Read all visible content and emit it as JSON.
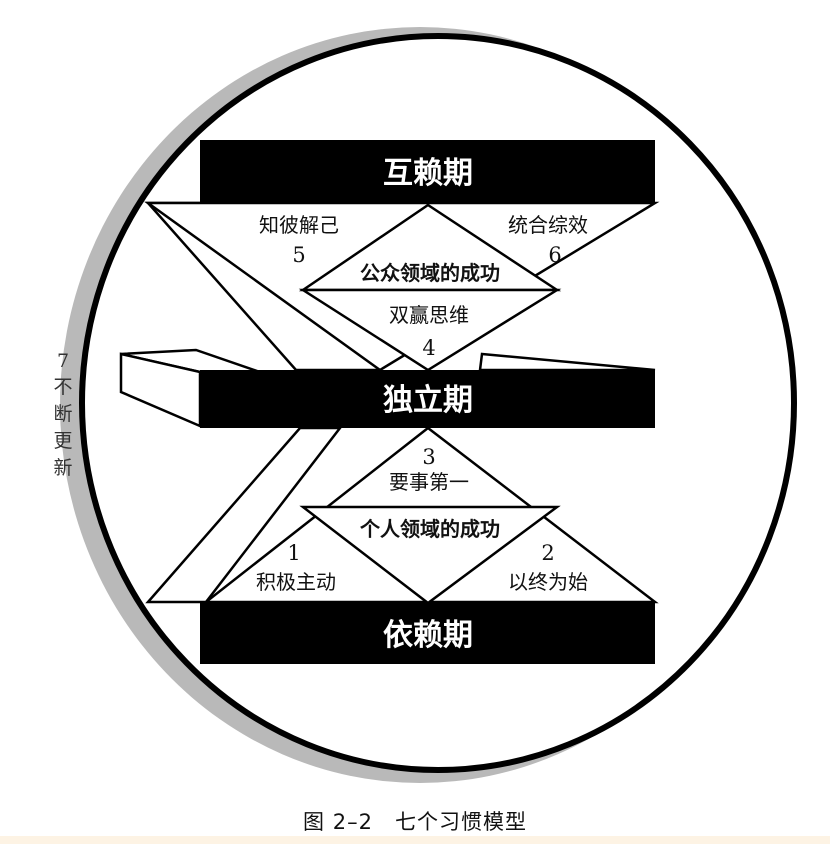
{
  "colors": {
    "ring_shadow": "#b9b9b9",
    "bar_fill": "#000000",
    "bottom_band": "#fdf3e4"
  },
  "bars": {
    "top": "互赖期",
    "middle": "独立期",
    "bottom": "依赖期"
  },
  "regions": {
    "public": "公众领域的成功",
    "private": "个人领域的成功"
  },
  "habits": [
    {
      "num": "1",
      "label": "积极主动"
    },
    {
      "num": "2",
      "label": "以终为始"
    },
    {
      "num": "3",
      "label": "要事第一"
    },
    {
      "num": "4",
      "label": "双赢思维"
    },
    {
      "num": "5",
      "label": "知彼解己"
    },
    {
      "num": "6",
      "label": "统合综效"
    }
  ],
  "side": {
    "num": "7",
    "chars": [
      "不",
      "断",
      "更",
      "新"
    ]
  },
  "caption": "图 2–2　七个习惯模型"
}
